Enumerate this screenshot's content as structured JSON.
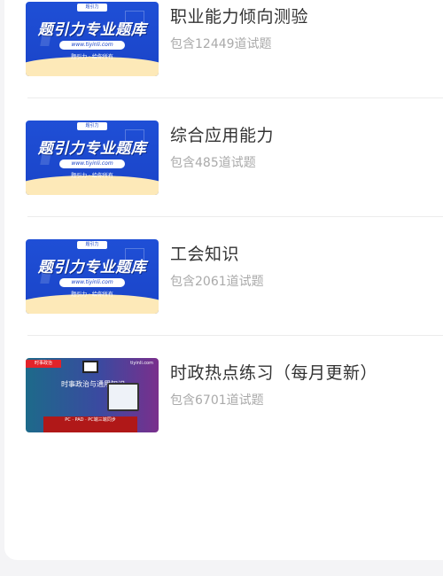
{
  "items": [
    {
      "title": "职业能力倾向测验",
      "count": "包含12449道试题",
      "thumb": {
        "brand": "题引力",
        "big": "题引力专业题库",
        "url": "www.tiyinli.com",
        "slogan": "题引力 · 给你所有"
      }
    },
    {
      "title": "综合应用能力",
      "count": "包含485道试题",
      "thumb": {
        "brand": "题引力",
        "big": "题引力专业题库",
        "url": "www.tiyinli.com",
        "slogan": "题引力 · 给你所有"
      }
    },
    {
      "title": "工会知识",
      "count": "包含2061道试题",
      "thumb": {
        "brand": "题引力",
        "big": "题引力专业题库",
        "url": "www.tiyinli.com",
        "slogan": "题引力 · 给你所有"
      }
    },
    {
      "title": "时政热点练习（每月更新）",
      "count": "包含6701道试题",
      "thumb": {
        "tag": "时事政治",
        "site": "tiyinli.com",
        "head": "时事政治与通用知识",
        "band": "PC · PAD · PC端三端同步"
      }
    }
  ]
}
